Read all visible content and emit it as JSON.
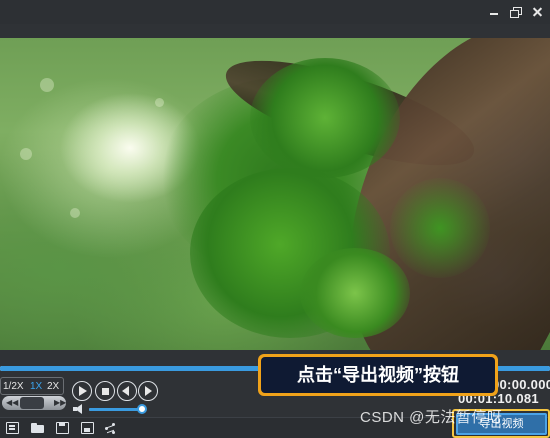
{
  "window": {
    "controls": [
      "minimize-icon",
      "restore-icon",
      "close-icon"
    ]
  },
  "player": {
    "progress_percent": 100,
    "speeds": {
      "half": "1/2X",
      "normal": "1X",
      "double": "2X",
      "selected": "1X"
    },
    "volume_percent": 100,
    "time_current": "00:00.000",
    "time_total": "00:01:10.081"
  },
  "toolbar": {
    "icons": [
      "new-icon",
      "open-icon",
      "save-icon",
      "save-as-icon",
      "share-icon"
    ],
    "export_label": "导出视频"
  },
  "callout": {
    "text": "点击“导出视频”按钮"
  },
  "watermark": "CSDN @无法暂停呀",
  "colors": {
    "accent": "#3a9be0",
    "callout_border": "#f0a21a",
    "callout_fill": "#0f1a33",
    "highlight": "#f4c542"
  }
}
